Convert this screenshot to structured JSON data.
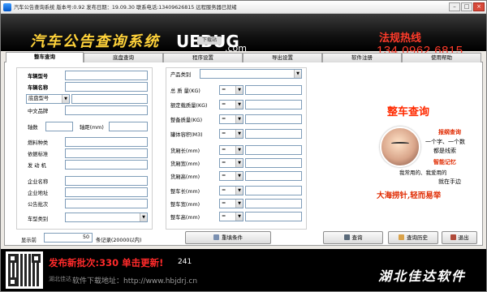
{
  "window": {
    "title": "汽车公告查询系统  版本号:0.92  发布日期：19.09.30   联系电话:13409626815   远程服务器已就绪",
    "buttons": {
      "min": "–",
      "max": "□",
      "close": "×"
    }
  },
  "banner": {
    "title": "汽车公告查询系统",
    "logo": "UEBUG",
    "logo_suffix": ".com",
    "download_tag": "下载站",
    "hotline_label": "法规热线",
    "hotline_number": "134 0962 6815"
  },
  "tabs": [
    {
      "label": "整车查询",
      "active": true
    },
    {
      "label": "底盘查询",
      "active": false
    },
    {
      "label": "程序设置",
      "active": false
    },
    {
      "label": "导出设置",
      "active": false
    },
    {
      "label": "软件注册",
      "active": false
    },
    {
      "label": "使用帮助",
      "active": false
    }
  ],
  "left_form": {
    "vehicle_model": "车辆型号",
    "vehicle_name": "车辆名称",
    "chassis_model": "底盘型号",
    "chinese_brand": "中文品牌",
    "wheelbase": "轴数",
    "wheelbase_mm": "轴距(mm)",
    "fuel_type": "燃料种类",
    "emission_std": "依据标准",
    "engine": "发 动 机",
    "company_name": "企业名称",
    "company_addr": "企业地址",
    "notice_batch": "公告批次",
    "vehicle_category": "车型类别"
  },
  "right_form": {
    "product_category": "产品类别",
    "total_mass": "总 质 量(KG)",
    "rated_load": "额定载质量(KG)",
    "curb_mass": "整备质量(KG)",
    "tank_volume": "罐体容积(M3)",
    "cargo_length": "货厢长(mm)",
    "cargo_width": "货厢宽(mm)",
    "cargo_height": "货厢高(mm)",
    "vehicle_length": "整车长(mm)",
    "vehicle_width": "整车宽(mm)",
    "vehicle_height": "整车高(mm)",
    "operator": "="
  },
  "hero": {
    "title": "整车查询",
    "slogan1": "报纲查询",
    "slogan2": "一个字、一个数",
    "slogan3": "都是线索",
    "slogan4": "智能记忆",
    "slogan5": "我常用的、我爱用的",
    "slogan6": "就在手边",
    "slogan7": "大海捞针,轻而易举"
  },
  "bottom": {
    "display_label": "显示前",
    "display_count": "50",
    "records_suffix": "条记录(20000以内)",
    "reset_button": "重填条件",
    "query_button": "查询",
    "history_button": "查询历史",
    "exit_button": "退出"
  },
  "footer": {
    "news": "发布新批次:330 单击更新!",
    "news_num": "241",
    "site_brand": "湖北佳达",
    "site": "软件下载地址：http://www.hbjdrj.cn",
    "brand": "湖北佳达软件"
  },
  "colors": {
    "accent_red": "#ff2a00",
    "hotline": "#ff3b2a",
    "banner_title": "#ffd23a"
  }
}
